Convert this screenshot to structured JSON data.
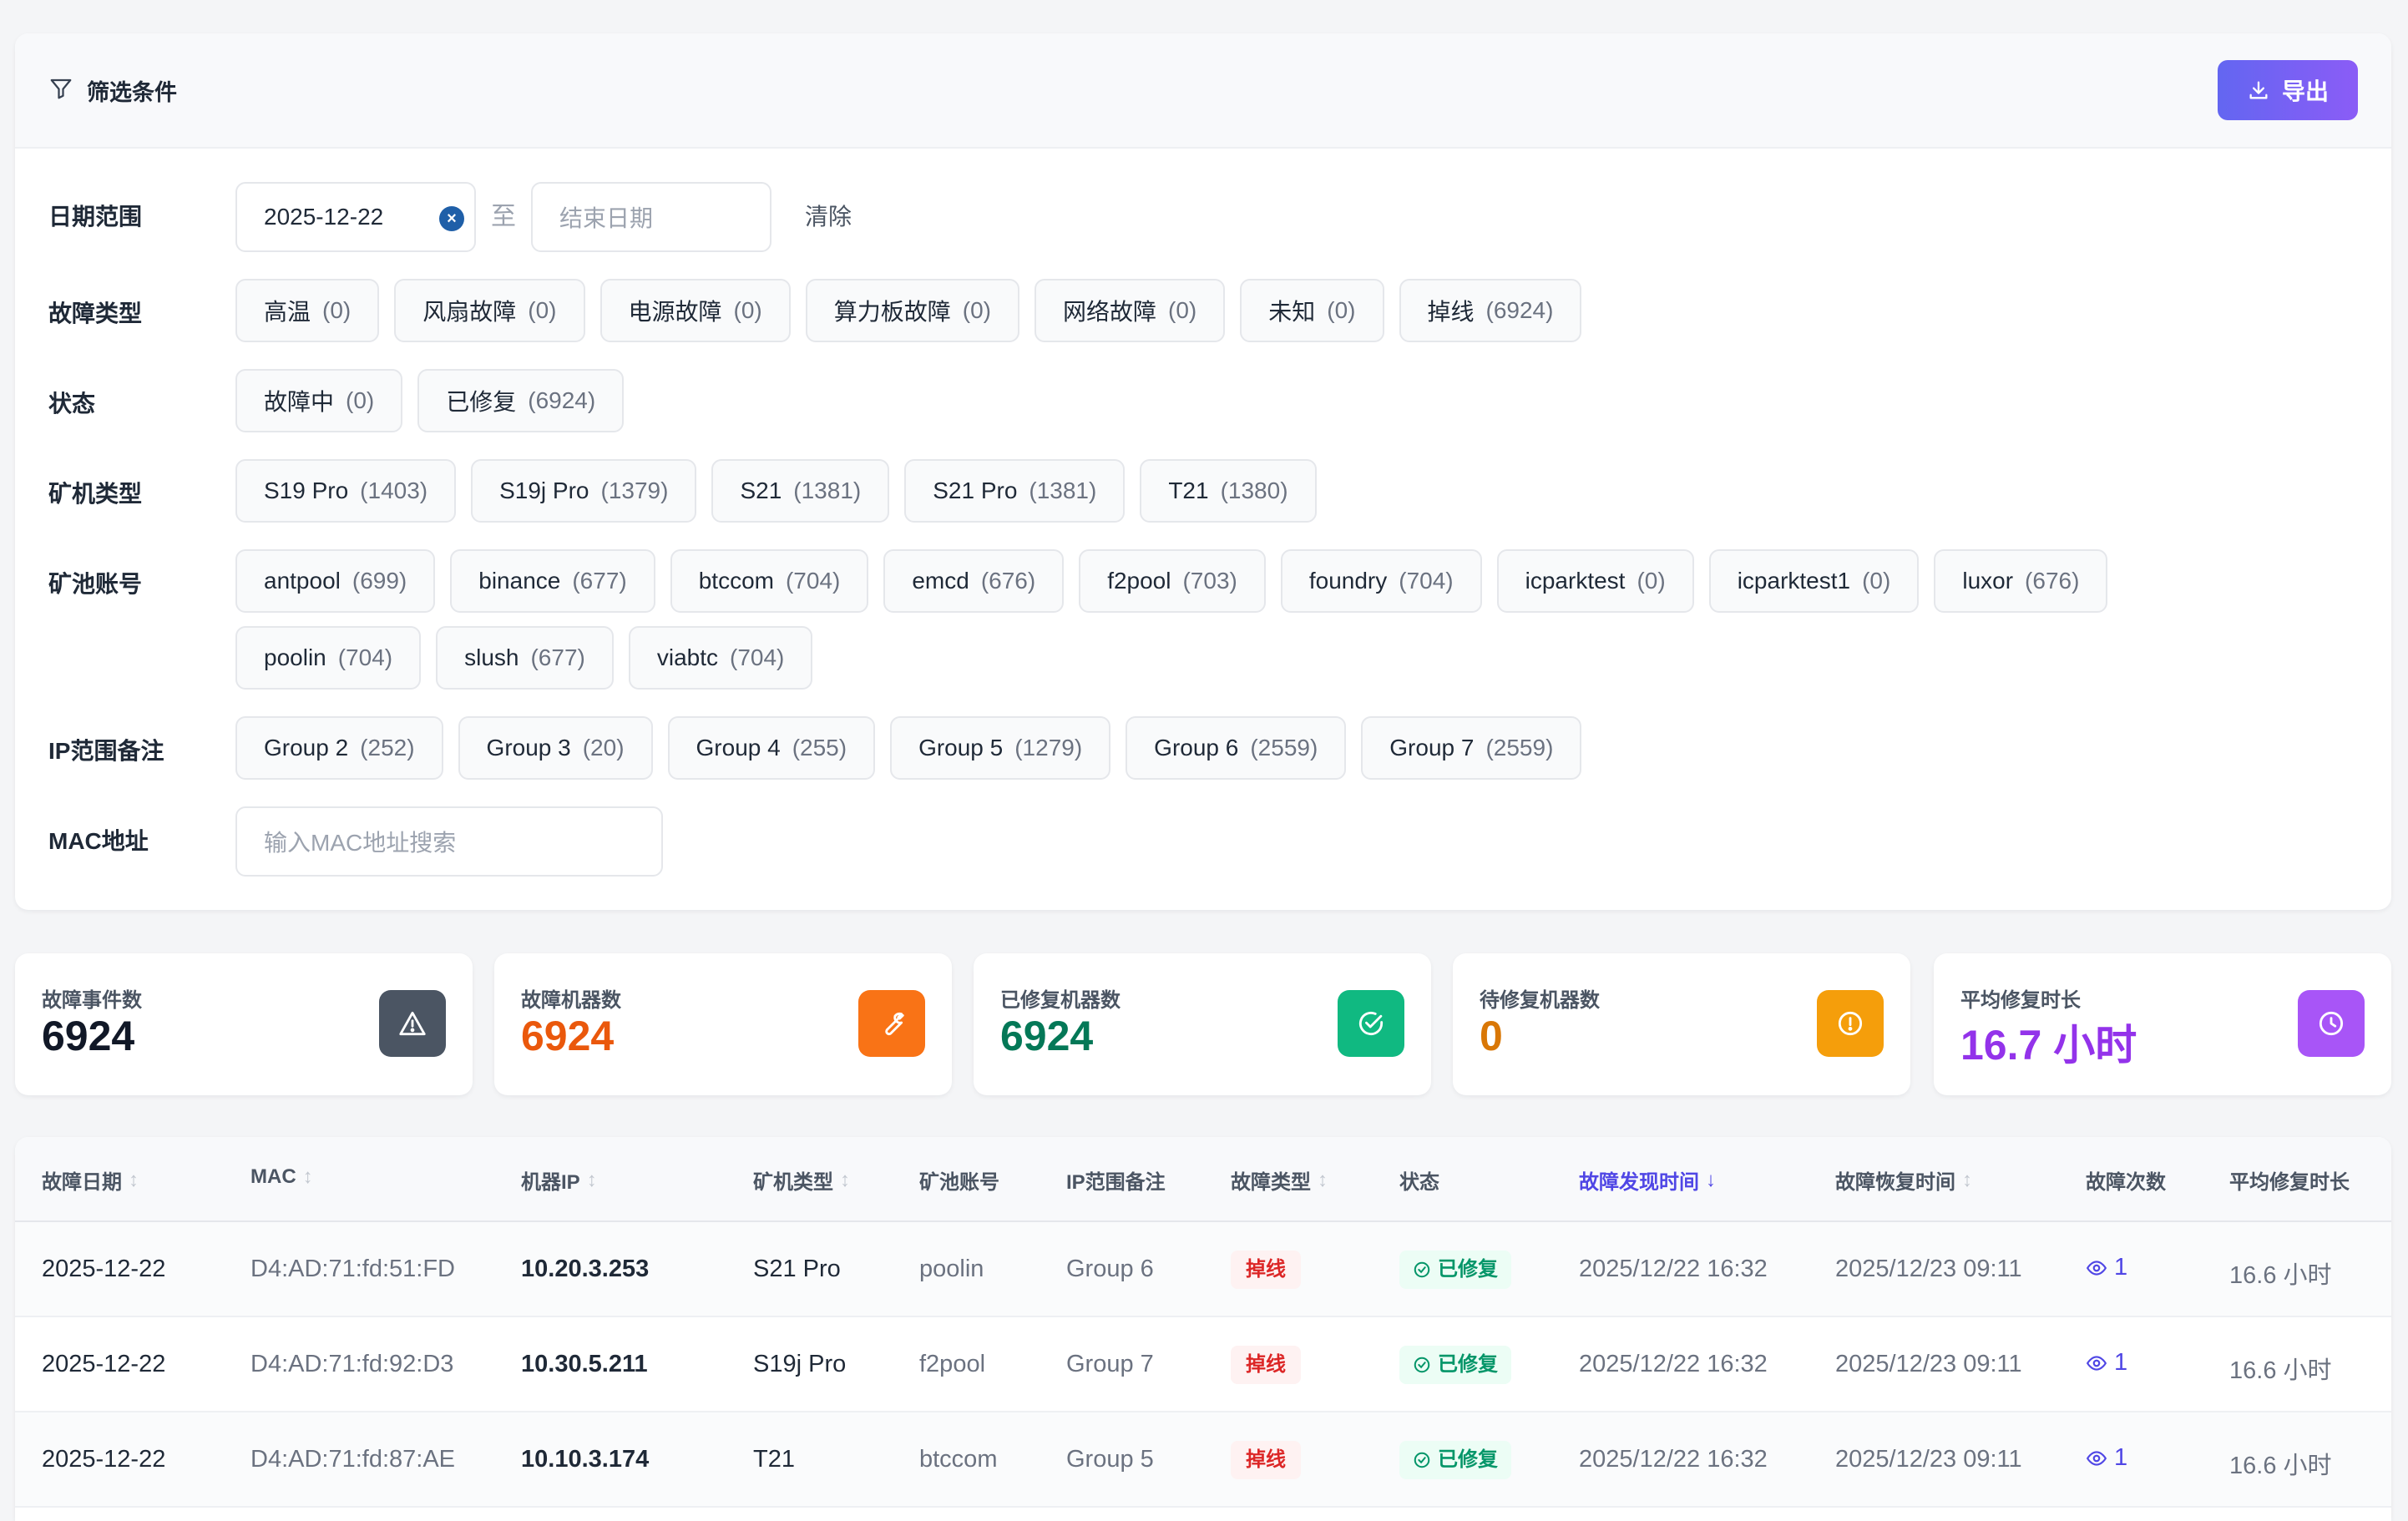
{
  "filter": {
    "title": "筛选条件",
    "export_label": "导出",
    "date_label": "日期范围",
    "start_date": "2025-12-22",
    "to_text": "至",
    "end_placeholder": "结束日期",
    "clear_label": "清除",
    "fault_type_label": "故障类型",
    "fault_types": [
      {
        "name": "高温",
        "count": "(0)"
      },
      {
        "name": "风扇故障",
        "count": "(0)"
      },
      {
        "name": "电源故障",
        "count": "(0)"
      },
      {
        "name": "算力板故障",
        "count": "(0)"
      },
      {
        "name": "网络故障",
        "count": "(0)"
      },
      {
        "name": "未知",
        "count": "(0)"
      },
      {
        "name": "掉线",
        "count": "(6924)"
      }
    ],
    "status_label": "状态",
    "statuses": [
      {
        "name": "故障中",
        "count": "(0)"
      },
      {
        "name": "已修复",
        "count": "(6924)"
      }
    ],
    "miner_type_label": "矿机类型",
    "miner_types": [
      {
        "name": "S19 Pro",
        "count": "(1403)"
      },
      {
        "name": "S19j Pro",
        "count": "(1379)"
      },
      {
        "name": "S21",
        "count": "(1381)"
      },
      {
        "name": "S21 Pro",
        "count": "(1381)"
      },
      {
        "name": "T21",
        "count": "(1380)"
      }
    ],
    "pool_label": "矿池账号",
    "pools": [
      {
        "name": "antpool",
        "count": "(699)"
      },
      {
        "name": "binance",
        "count": "(677)"
      },
      {
        "name": "btccom",
        "count": "(704)"
      },
      {
        "name": "emcd",
        "count": "(676)"
      },
      {
        "name": "f2pool",
        "count": "(703)"
      },
      {
        "name": "foundry",
        "count": "(704)"
      },
      {
        "name": "icparktest",
        "count": "(0)"
      },
      {
        "name": "icparktest1",
        "count": "(0)"
      },
      {
        "name": "luxor",
        "count": "(676)"
      },
      {
        "name": "poolin",
        "count": "(704)"
      },
      {
        "name": "slush",
        "count": "(677)"
      },
      {
        "name": "viabtc",
        "count": "(704)"
      }
    ],
    "ip_label": "IP范围备注",
    "ip_groups": [
      {
        "name": "Group 2",
        "count": "(252)"
      },
      {
        "name": "Group 3",
        "count": "(20)"
      },
      {
        "name": "Group 4",
        "count": "(255)"
      },
      {
        "name": "Group 5",
        "count": "(1279)"
      },
      {
        "name": "Group 6",
        "count": "(2559)"
      },
      {
        "name": "Group 7",
        "count": "(2559)"
      }
    ],
    "mac_label": "MAC地址",
    "mac_placeholder": "输入MAC地址搜索"
  },
  "stats": [
    {
      "label": "故障事件数",
      "value": "6924",
      "color": "#111827",
      "icon_bg": "#4b5563",
      "icon": "warning-icon"
    },
    {
      "label": "故障机器数",
      "value": "6924",
      "color": "#ea580c",
      "icon_bg": "#f97316",
      "icon": "wrench-icon"
    },
    {
      "label": "已修复机器数",
      "value": "6924",
      "color": "#047857",
      "icon_bg": "#10b981",
      "icon": "check-circle-icon"
    },
    {
      "label": "待修复机器数",
      "value": "0",
      "color": "#d97706",
      "icon_bg": "#f59e0b",
      "icon": "alert-circle-icon"
    },
    {
      "label": "平均修复时长",
      "value": "16.7 小时",
      "color": "#9333ea",
      "icon_bg": "#a855f7",
      "icon": "clock-icon"
    }
  ],
  "table": {
    "columns": [
      "故障日期",
      "MAC",
      "机器IP",
      "矿机类型",
      "矿池账号",
      "IP范围备注",
      "故障类型",
      "状态",
      "故障发现时间",
      "故障恢复时间",
      "故障次数",
      "平均修复时长"
    ],
    "rows": [
      {
        "date": "2025-12-22",
        "mac": "D4:AD:71:fd:51:FD",
        "ip": "10.20.3.253",
        "miner": "S21 Pro",
        "pool": "poolin",
        "group": "Group 6",
        "fault": "掉线",
        "status": "已修复",
        "found": "2025/12/22 16:32",
        "recovered": "2025/12/23 09:11",
        "times": "1",
        "avg": "16.6 小时"
      },
      {
        "date": "2025-12-22",
        "mac": "D4:AD:71:fd:92:D3",
        "ip": "10.30.5.211",
        "miner": "S19j Pro",
        "pool": "f2pool",
        "group": "Group 7",
        "fault": "掉线",
        "status": "已修复",
        "found": "2025/12/22 16:32",
        "recovered": "2025/12/23 09:11",
        "times": "1",
        "avg": "16.6 小时"
      },
      {
        "date": "2025-12-22",
        "mac": "D4:AD:71:fd:87:AE",
        "ip": "10.10.3.174",
        "miner": "T21",
        "pool": "btccom",
        "group": "Group 5",
        "fault": "掉线",
        "status": "已修复",
        "found": "2025/12/22 16:32",
        "recovered": "2025/12/23 09:11",
        "times": "1",
        "avg": "16.6 小时"
      }
    ]
  }
}
